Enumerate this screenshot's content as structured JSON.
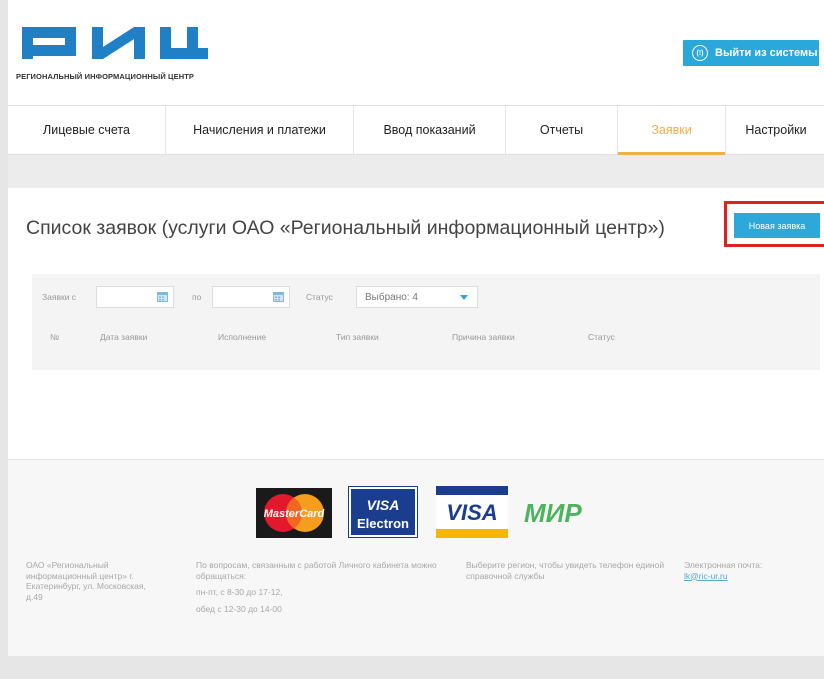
{
  "header": {
    "logo_text": "РЕГИОНАЛЬНЫЙ ИНФОРМАЦИОННЫЙ ЦЕНТР",
    "logout_label": "Выйти из системы",
    "logout_icon_text": "(!)"
  },
  "nav": {
    "items": [
      {
        "label": "Лицевые счета"
      },
      {
        "label": "Начисления и платежи"
      },
      {
        "label": "Ввод показаний"
      },
      {
        "label": "Отчеты"
      },
      {
        "label": "Заявки",
        "active": true
      },
      {
        "label": "Настройки"
      }
    ]
  },
  "main": {
    "title": "Список заявок (услуги ОАО «Региональный информационный центр»)",
    "new_request_label": "Новая заявка",
    "filter": {
      "from_label": "Заявки с",
      "to_label": "по",
      "status_label": "Статус",
      "status_value": "Выбрано: 4"
    },
    "columns": [
      "№",
      "Дата заявки",
      "Исполнение",
      "Тип заявки",
      "Причина заявки",
      "Статус"
    ]
  },
  "footer": {
    "payments": [
      "MasterCard",
      "VISA Electron",
      "VISA",
      "МИР"
    ],
    "company": "ОАО «Региональный информационный центр» г. Екатеринбург, ул. Московская, д.49",
    "contact_text": "По вопросам, связанным с работой Личного кабинета можно обращаться:",
    "hours_1": "пн-пт, с 8-30 до 17-12,",
    "hours_2": "обед с 12-30 до 14-00",
    "region_text": "Выберите регион, чтобы увидеть телефон единой справочной службы",
    "email_label": "Электронная почта:",
    "email_value": "lk@ric-ur.ru"
  },
  "colors": {
    "accent": "#2ea7da",
    "active_tab": "#f0b04a",
    "highlight_border": "#dd2222"
  }
}
